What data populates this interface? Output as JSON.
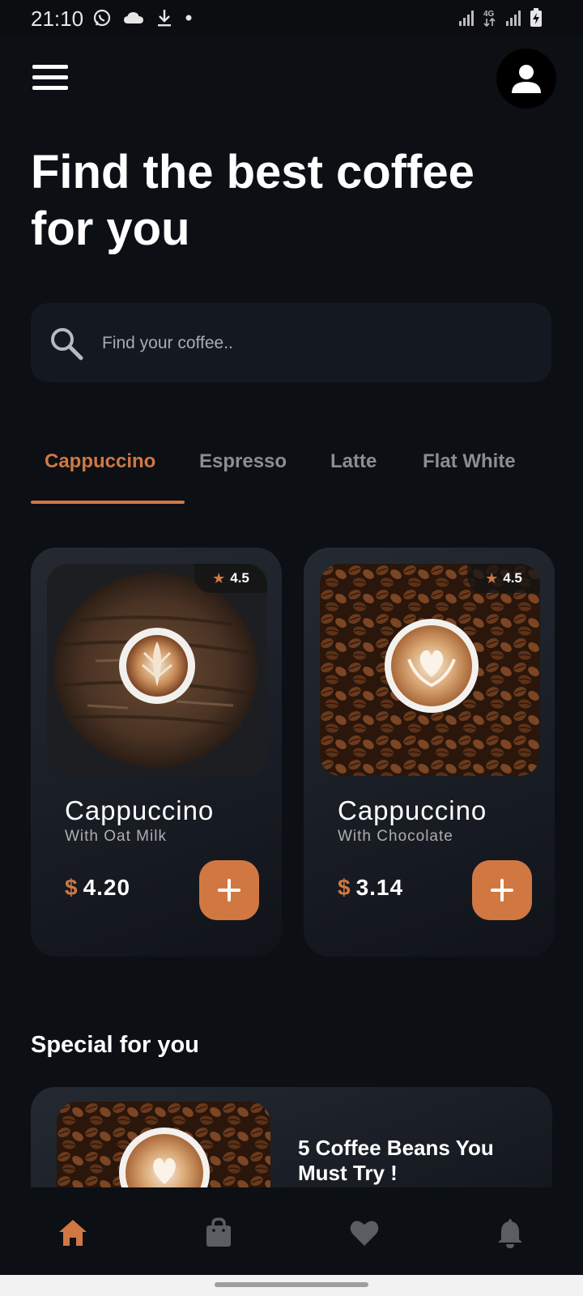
{
  "status_bar": {
    "time": "21:10"
  },
  "header": {
    "headline": "Find the best coffee for you"
  },
  "search": {
    "placeholder": "Find your coffee.."
  },
  "tabs": [
    {
      "label": "Cappuccino",
      "active": true
    },
    {
      "label": "Espresso",
      "active": false
    },
    {
      "label": "Latte",
      "active": false
    },
    {
      "label": "Flat White",
      "active": false
    }
  ],
  "products": [
    {
      "rating": "4.5",
      "name": "Cappuccino",
      "subtitle": "With Oat Milk",
      "currency": "$",
      "price": "4.20"
    },
    {
      "rating": "4.5",
      "name": "Cappuccino",
      "subtitle": "With Chocolate",
      "currency": "$",
      "price": "3.14"
    }
  ],
  "special": {
    "title": "Special for you",
    "items": [
      {
        "title": "5 Coffee Beans You Must Try !"
      }
    ]
  },
  "bottom_nav": [
    {
      "icon": "home-icon",
      "active": true
    },
    {
      "icon": "bag-icon",
      "active": false
    },
    {
      "icon": "heart-icon",
      "active": false
    },
    {
      "icon": "bell-icon",
      "active": false
    }
  ],
  "colors": {
    "accent": "#d17842",
    "background": "#0c0f14",
    "surface": "#141921",
    "inactive": "#8b8d90"
  }
}
